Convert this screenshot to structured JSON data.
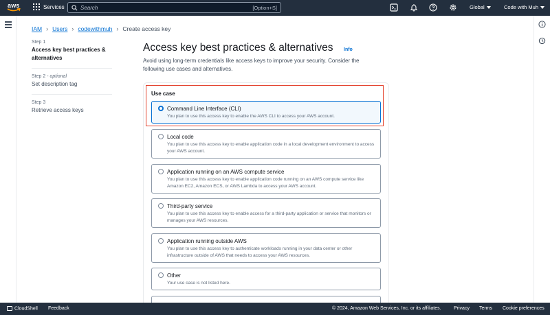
{
  "topnav": {
    "logo_text": "aws",
    "services_label": "Services",
    "search_placeholder": "Search",
    "search_shortcut": "[Option+S]",
    "region_label": "Global",
    "user_label": "Code with Muh"
  },
  "breadcrumb": {
    "items": [
      "IAM",
      "Users",
      "codewithmuh"
    ],
    "current": "Create access key"
  },
  "steps": [
    {
      "num": "Step 1",
      "optional": "",
      "title": "Access key best practices & alternatives"
    },
    {
      "num": "Step 2",
      "optional": "optional",
      "title": "Set description tag"
    },
    {
      "num": "Step 3",
      "optional": "",
      "title": "Retrieve access keys"
    }
  ],
  "main": {
    "title": "Access key best practices & alternatives",
    "info_link": "Info",
    "description": "Avoid using long-term credentials like access keys to improve your security. Consider the following use cases and alternatives.",
    "use_case_label": "Use case"
  },
  "options": [
    {
      "title": "Command Line Interface (CLI)",
      "desc": "You plan to use this access key to enable the AWS CLI to access your AWS account.",
      "selected": true
    },
    {
      "title": "Local code",
      "desc": "You plan to use this access key to enable application code in a local development environment to access your AWS account.",
      "selected": false
    },
    {
      "title": "Application running on an AWS compute service",
      "desc": "You plan to use this access key to enable application code running on an AWS compute service like Amazon EC2, Amazon ECS, or AWS Lambda to access your AWS account.",
      "selected": false
    },
    {
      "title": "Third-party service",
      "desc": "You plan to use this access key to enable access for a third-party application or service that monitors or manages your AWS resources.",
      "selected": false
    },
    {
      "title": "Application running outside AWS",
      "desc": "You plan to use this access key to authenticate workloads running in your data center or other infrastructure outside of AWS that needs to access your AWS resources.",
      "selected": false
    },
    {
      "title": "Other",
      "desc": "Your use case is not listed here.",
      "selected": false
    }
  ],
  "footer": {
    "cloudshell": "CloudShell",
    "feedback": "Feedback",
    "copyright": "© 2024, Amazon Web Services, Inc. or its affiliates.",
    "privacy": "Privacy",
    "terms": "Terms",
    "cookies": "Cookie preferences"
  },
  "colors": {
    "nav_bg": "#232f3e",
    "link": "#0972d3",
    "highlight_border": "#e4432e"
  },
  "icons": [
    "aws-logo-icon",
    "grid-icon",
    "search-icon",
    "cloudshell-icon",
    "bell-icon",
    "help-icon",
    "settings-icon",
    "hamburger-icon",
    "info-circle-icon",
    "clock-icon"
  ]
}
